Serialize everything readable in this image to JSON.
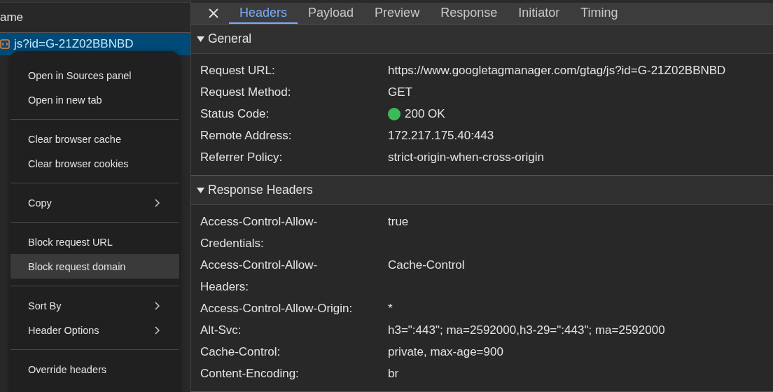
{
  "requests": {
    "column_header": "ame",
    "rows": [
      {
        "name": "js?id=G-21Z02BBNBD",
        "selected": true
      }
    ]
  },
  "context_menu": {
    "groups": [
      [
        {
          "label": "Open in Sources panel",
          "submenu": false,
          "hovered": false
        },
        {
          "label": "Open in new tab",
          "submenu": false,
          "hovered": false
        }
      ],
      [
        {
          "label": "Clear browser cache",
          "submenu": false,
          "hovered": false
        },
        {
          "label": "Clear browser cookies",
          "submenu": false,
          "hovered": false
        }
      ],
      [
        {
          "label": "Copy",
          "submenu": true,
          "hovered": false
        }
      ],
      [
        {
          "label": "Block request URL",
          "submenu": false,
          "hovered": false
        },
        {
          "label": "Block request domain",
          "submenu": false,
          "hovered": true
        }
      ],
      [
        {
          "label": "Sort By",
          "submenu": true,
          "hovered": false
        },
        {
          "label": "Header Options",
          "submenu": true,
          "hovered": false
        }
      ],
      [
        {
          "label": "Override headers",
          "submenu": false,
          "hovered": false
        }
      ]
    ]
  },
  "tabs": [
    {
      "label": "Headers",
      "selected": true
    },
    {
      "label": "Payload",
      "selected": false
    },
    {
      "label": "Preview",
      "selected": false
    },
    {
      "label": "Response",
      "selected": false
    },
    {
      "label": "Initiator",
      "selected": false
    },
    {
      "label": "Timing",
      "selected": false
    }
  ],
  "sections": [
    {
      "title": "General",
      "expanded": true,
      "rows": [
        {
          "name": "Request URL:",
          "value": "https://www.googletagmanager.com/gtag/js?id=G-21Z02BBNBD"
        },
        {
          "name": "Request Method:",
          "value": "GET"
        },
        {
          "name": "Status Code:",
          "value": "200 OK",
          "kind": "status"
        },
        {
          "name": "Remote Address:",
          "value": "172.217.175.40:443"
        },
        {
          "name": "Referrer Policy:",
          "value": "strict-origin-when-cross-origin"
        }
      ]
    },
    {
      "title": "Response Headers",
      "expanded": true,
      "rows": [
        {
          "name": "Access-Control-Allow-Credentials:",
          "value": "true"
        },
        {
          "name": "Access-Control-Allow-Headers:",
          "value": "Cache-Control"
        },
        {
          "name": "Access-Control-Allow-Origin:",
          "value": "*"
        },
        {
          "name": "Alt-Svc:",
          "value": "h3=\":443\"; ma=2592000,h3-29=\":443\"; ma=2592000"
        },
        {
          "name": "Cache-Control:",
          "value": "private, max-age=900"
        },
        {
          "name": "Content-Encoding:",
          "value": "br"
        }
      ]
    }
  ]
}
